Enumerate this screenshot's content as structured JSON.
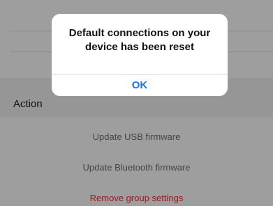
{
  "background": {
    "section_header": "Action",
    "actions": [
      {
        "label": "Update USB firmware",
        "style": "muted"
      },
      {
        "label": "Update Bluetooth firmware",
        "style": "muted"
      },
      {
        "label": "Remove group settings",
        "style": "destructive"
      }
    ]
  },
  "alert": {
    "message": "Default connections on your device has been reset",
    "ok_label": "OK"
  },
  "colors": {
    "accent": "#1a73e8",
    "destructive": "#e0352b",
    "muted_text": "#6e6e73"
  }
}
